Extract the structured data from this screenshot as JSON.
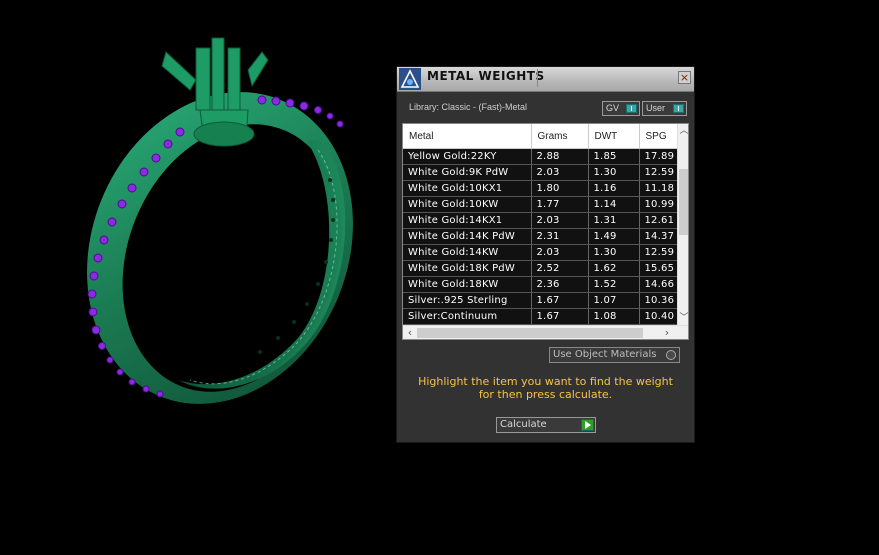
{
  "window": {
    "title": "METAL WEIGHTS",
    "close_glyph": "×"
  },
  "library_label": "Library: Classic - (Fast)-Metal",
  "toggles": {
    "gv": "GV",
    "user": "User"
  },
  "table": {
    "columns": [
      "Metal",
      "Grams",
      "DWT",
      "SPG"
    ],
    "rows": [
      [
        "Yellow Gold:22KY",
        "2.88",
        "1.85",
        "17.89"
      ],
      [
        "White Gold:9K PdW",
        "2.03",
        "1.30",
        "12.59"
      ],
      [
        "White Gold:10KX1",
        "1.80",
        "1.16",
        "11.18"
      ],
      [
        "White Gold:10KW",
        "1.77",
        "1.14",
        "10.99"
      ],
      [
        "White Gold:14KX1",
        "2.03",
        "1.31",
        "12.61"
      ],
      [
        "White Gold:14K PdW",
        "2.31",
        "1.49",
        "14.37"
      ],
      [
        "White Gold:14KW",
        "2.03",
        "1.30",
        "12.59"
      ],
      [
        "White Gold:18K PdW",
        "2.52",
        "1.62",
        "15.65"
      ],
      [
        "White Gold:18KW",
        "2.36",
        "1.52",
        "14.66"
      ],
      [
        "Silver:.925 Sterling",
        "1.67",
        "1.07",
        "10.36"
      ],
      [
        "Silver:Continuum",
        "1.67",
        "1.08",
        "10.40"
      ]
    ]
  },
  "use_object_materials": "Use Object Materials",
  "hint_line1": "Highlight the item you want to find the weight",
  "hint_line2": "for then press calculate.",
  "calculate_label": "Calculate",
  "colors": {
    "ring_green": "#1f8a5c",
    "stone_purple": "#8a2be2",
    "hint_yellow": "#f4c542",
    "toggle_teal": "#3aa7a7",
    "calc_green": "#2e9e2e"
  },
  "icons": {
    "app_logo": "app-logo-icon",
    "close": "close-icon",
    "toggle": "toggle-indicator-icon",
    "radio": "radio-icon",
    "play": "play-icon"
  }
}
